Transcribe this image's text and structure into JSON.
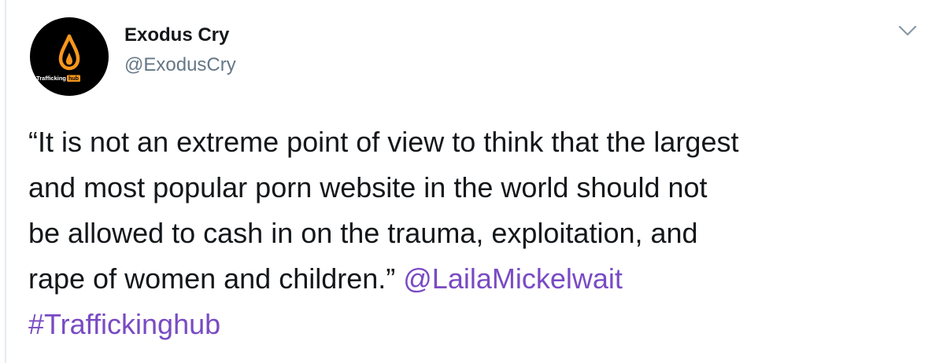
{
  "tweet": {
    "author": {
      "display_name": "Exodus Cry",
      "handle": "@ExodusCry",
      "avatar_text": "Traffickinghub"
    },
    "menu_icon": "chevron-down-icon",
    "text_lines": [
      "“It is not an extreme point of view to think that the largest",
      "and most popular porn website in the world should not",
      "be allowed to cash in on the trauma, exploitation, and",
      "rape of women and children.” "
    ],
    "mention": "@LailaMickelwait",
    "hashtag": "#Traffickinghub"
  },
  "colors": {
    "link": "#794bc4",
    "text": "#14171a",
    "secondary": "#657786",
    "avatar_bg": "#000000",
    "brand_orange": "#f7971d"
  }
}
